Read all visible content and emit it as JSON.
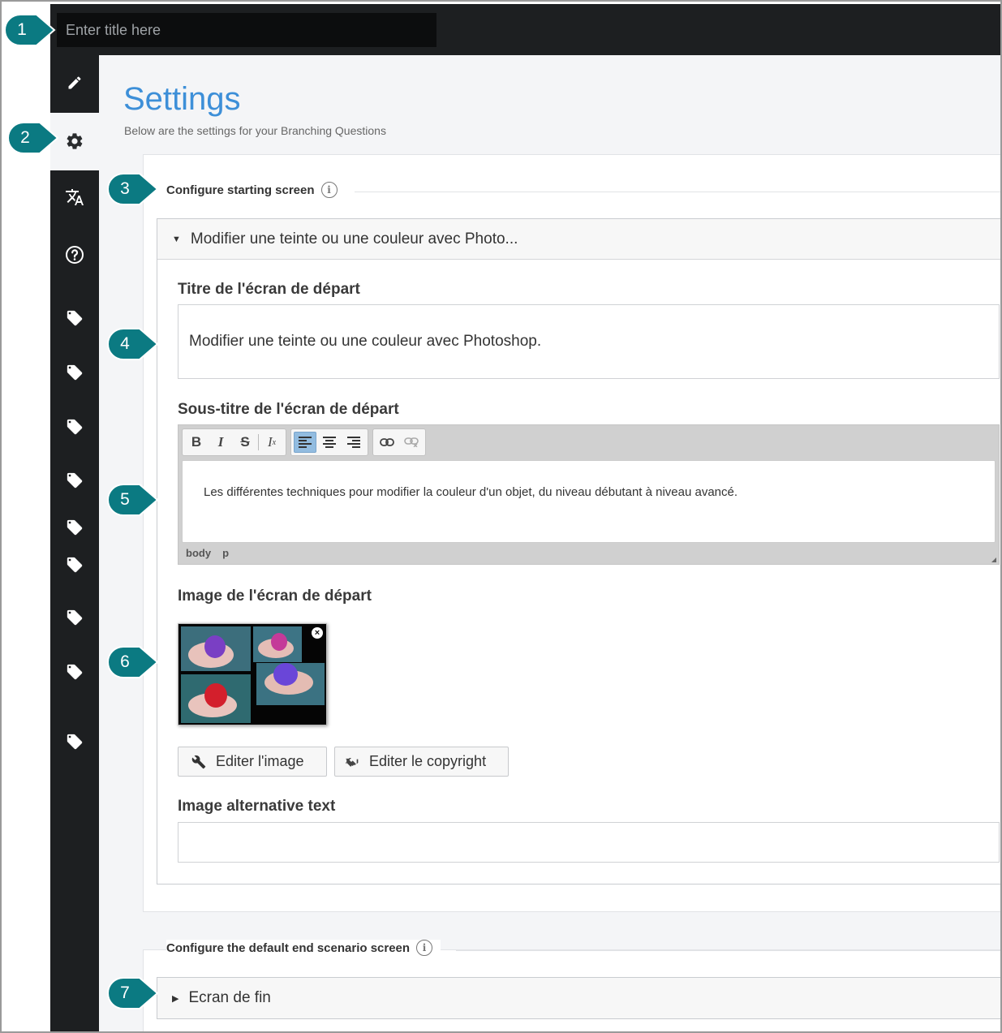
{
  "header": {
    "title_placeholder": "Enter title here"
  },
  "sidebar": {
    "icons": [
      "pencil-icon",
      "gear-icon",
      "translate-icon",
      "help-icon",
      "tag-icon",
      "tag-icon",
      "tag-icon",
      "tag-icon",
      "tag-icon",
      "tag-icon",
      "tag-icon",
      "tag-icon",
      "tag-icon"
    ]
  },
  "page": {
    "title": "Settings",
    "subtitle": "Below are the settings for your Branching Questions"
  },
  "starting_screen": {
    "legend": "Configure starting screen",
    "accordion_title": "Modifier une teinte ou une couleur avec Photo...",
    "title_label": "Titre de l'écran de départ",
    "title_value": "Modifier une teinte ou une couleur avec Photoshop.",
    "subtitle_label": "Sous-titre de l'écran de départ",
    "subtitle_value": "Les différentes techniques pour modifier la couleur d'un objet, du niveau débutant à niveau avancé.",
    "editor_path": [
      "body",
      "p"
    ],
    "image_label": "Image de l'écran de départ",
    "edit_image_button": "Editer l'image",
    "edit_copyright_button": "Editer le copyright",
    "alt_text_label": "Image alternative text",
    "alt_text_value": ""
  },
  "end_screen": {
    "legend": "Configure the default end scenario screen",
    "accordion_title": "Ecran de fin"
  },
  "callouts": [
    "1",
    "2",
    "3",
    "4",
    "5",
    "6",
    "7"
  ],
  "colors": {
    "dark": "#1d1f21",
    "accent": "#3d8fd8",
    "callout": "#0b7a82"
  }
}
